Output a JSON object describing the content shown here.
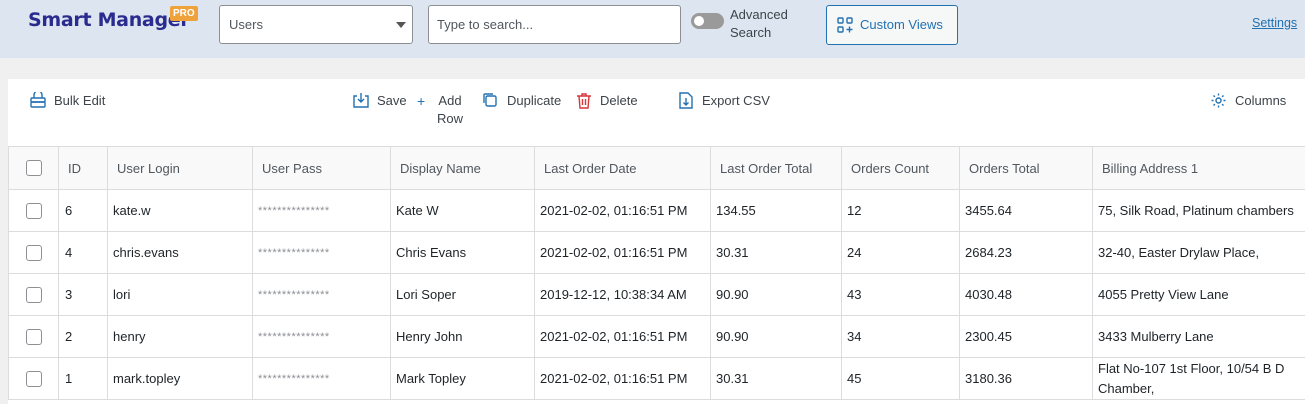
{
  "header": {
    "brand": "Smart Manager",
    "badge": "PRO",
    "dashboard_select": "Users",
    "search_placeholder": "Type to search...",
    "advanced_search_label": "Advanced Search",
    "custom_views_label": "Custom Views",
    "settings_label": "Settings"
  },
  "toolbar": {
    "bulk_edit": "Bulk Edit",
    "save": "Save",
    "add_row": "Add Row",
    "duplicate": "Duplicate",
    "delete": "Delete",
    "export_csv": "Export CSV",
    "columns": "Columns"
  },
  "colors": {
    "accent": "#2271b1",
    "brand": "#2a2b8f",
    "pro_badge": "#f0a23a",
    "delete": "#d63638",
    "header_bg": "#dde6f0"
  },
  "table": {
    "columns": [
      "ID",
      "User Login",
      "User Pass",
      "Display Name",
      "Last Order Date",
      "Last Order Total",
      "Orders Count",
      "Orders Total",
      "Billing Address 1"
    ],
    "rows": [
      {
        "id": "6",
        "login": "kate.w",
        "pass": "***************",
        "display": "Kate W",
        "last_order_date": "2021-02-02, 01:16:51 PM",
        "last_order_total": "134.55",
        "orders_count": "12",
        "orders_total": "3455.64",
        "billing": "75, Silk Road, Platinum chambers"
      },
      {
        "id": "4",
        "login": "chris.evans",
        "pass": "***************",
        "display": "Chris Evans",
        "last_order_date": "2021-02-02, 01:16:51 PM",
        "last_order_total": "30.31",
        "orders_count": "24",
        "orders_total": "2684.23",
        "billing": "32-40, Easter Drylaw Place,"
      },
      {
        "id": "3",
        "login": "lori",
        "pass": "***************",
        "display": "Lori Soper",
        "last_order_date": "2019-12-12, 10:38:34 AM",
        "last_order_total": "90.90",
        "orders_count": "43",
        "orders_total": "4030.48",
        "billing": "4055 Pretty View Lane"
      },
      {
        "id": "2",
        "login": "henry",
        "pass": "***************",
        "display": "Henry John",
        "last_order_date": "2021-02-02, 01:16:51 PM",
        "last_order_total": "90.90",
        "orders_count": "34",
        "orders_total": "2300.45",
        "billing": "3433 Mulberry Lane"
      },
      {
        "id": "1",
        "login": "mark.topley",
        "pass": "***************",
        "display": "Mark Topley",
        "last_order_date": "2021-02-02, 01:16:51 PM",
        "last_order_total": "30.31",
        "orders_count": "45",
        "orders_total": "3180.36",
        "billing": "Flat No-107 1st Floor, 10/54 B D Chamber,"
      }
    ]
  }
}
